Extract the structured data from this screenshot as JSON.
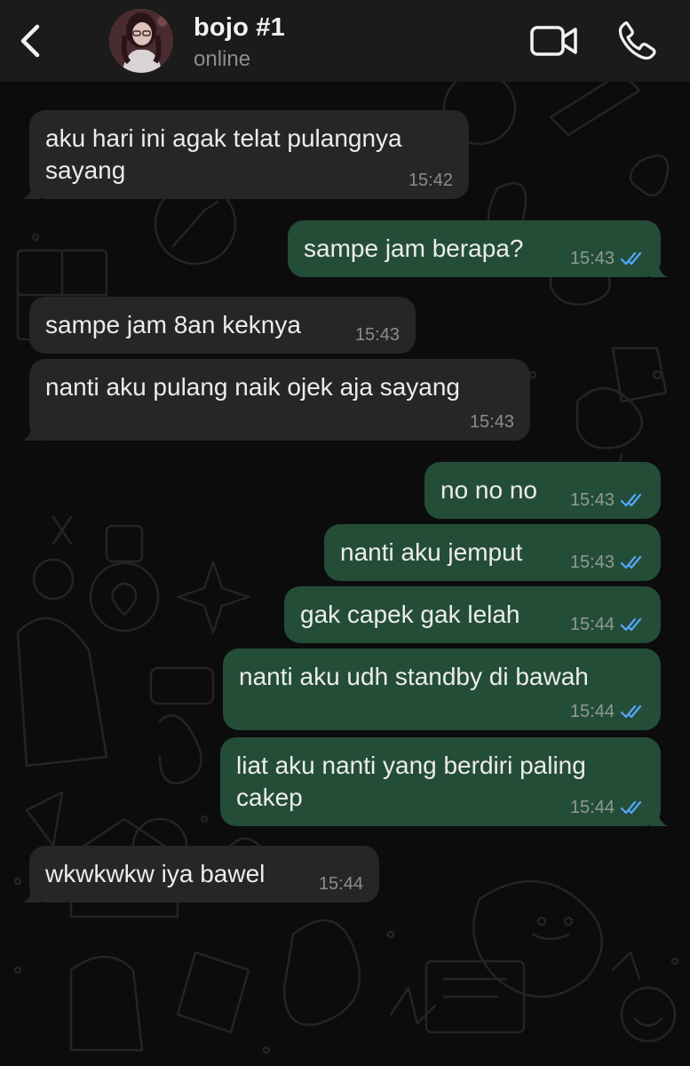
{
  "header": {
    "back_icon": "chevron-left-icon",
    "contact_name": "bojo #1",
    "status": "online",
    "video_icon": "video-camera-icon",
    "call_icon": "phone-icon"
  },
  "colors": {
    "header_bg": "#1b1b1b",
    "chat_bg": "#0c0c0c",
    "incoming_bubble": "#262626",
    "outgoing_bubble": "#244d38",
    "read_tick": "#53a6ff"
  },
  "messages": [
    {
      "direction": "in",
      "text": "aku hari ini agak telat pulangnya sayang",
      "time": "15:42"
    },
    {
      "direction": "out",
      "text": "sampe jam berapa?",
      "time": "15:43",
      "status": "read"
    },
    {
      "direction": "in",
      "text": "sampe jam 8an keknya",
      "time": "15:43"
    },
    {
      "direction": "in",
      "text": "nanti aku pulang naik ojek aja sayang",
      "time": "15:43"
    },
    {
      "direction": "out",
      "text": "no no no",
      "time": "15:43",
      "status": "read"
    },
    {
      "direction": "out",
      "text": "nanti aku jemput",
      "time": "15:43",
      "status": "read"
    },
    {
      "direction": "out",
      "text": "gak capek gak lelah",
      "time": "15:44",
      "status": "read"
    },
    {
      "direction": "out",
      "text": "nanti aku udh standby di bawah",
      "time": "15:44",
      "status": "read"
    },
    {
      "direction": "out",
      "text": "liat aku nanti yang berdiri paling cakep",
      "time": "15:44",
      "status": "read"
    },
    {
      "direction": "in",
      "text": "wkwkwkw iya bawel",
      "time": "15:44"
    }
  ]
}
